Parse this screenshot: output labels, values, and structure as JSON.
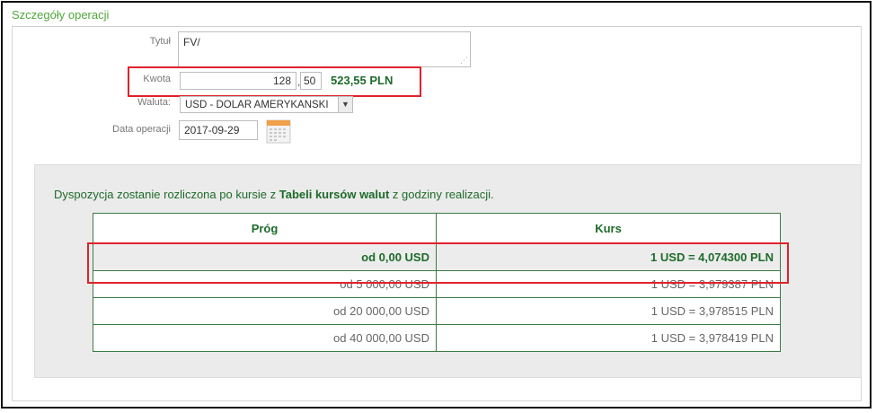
{
  "section": {
    "title": "Szczegóły operacji"
  },
  "form": {
    "title_label": "Tytuł",
    "title_value": "FV/",
    "amount_label": "Kwota",
    "amount_integer": "128",
    "amount_separator": ",",
    "amount_decimal": "50",
    "amount_pln": "523,55 PLN",
    "currency_label": "Waluta:",
    "currency_value": "USD - DOLAR AMERYKANSKI",
    "date_label": "Data operacji",
    "date_value": "2017-09-29",
    "calendar_icon": "calendar-icon"
  },
  "info": {
    "prefix": "Dyspozycja zostanie rozliczona po kursie z ",
    "link": "Tabeli kursów walut",
    "suffix": " z godziny realizacji."
  },
  "rates": {
    "headers": [
      "Próg",
      "Kurs"
    ],
    "rows": [
      {
        "threshold": "od 0,00 USD",
        "rate": "1 USD = 4,074300 PLN"
      },
      {
        "threshold": "od 5 000,00 USD",
        "rate": "1 USD = 3,979387 PLN"
      },
      {
        "threshold": "od 20 000,00 USD",
        "rate": "1 USD = 3,978515 PLN"
      },
      {
        "threshold": "od 40 000,00 USD",
        "rate": "1 USD = 3,978419 PLN"
      }
    ]
  },
  "colors": {
    "accent_green": "#1e6b2a",
    "title_green": "#4fa83a",
    "highlight_red": "#e0222b"
  }
}
